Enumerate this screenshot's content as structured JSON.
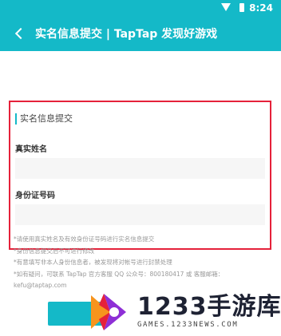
{
  "status_bar": {
    "time": "8:24"
  },
  "app_bar": {
    "title": "实名信息提交 | TapTap 发现好游戏"
  },
  "form": {
    "section_title": "实名信息提交",
    "name_label": "真实姓名",
    "id_label": "身份证号码"
  },
  "notes": [
    "*请使用真实姓名及有效身份证号码进行实名信息提交",
    "*身份信息提交后不可进行修改",
    "*有意填写非本人身份信息者，被发现将对帐号进行封禁处理",
    "*如有疑问，可联系 TapTap 官方客服 QQ 公众号：800180417 或 客服邮箱：",
    "kefu@taptap.com"
  ],
  "watermark": {
    "brand": "1233手游库",
    "domain": "GAMES.1233NEWS.COM",
    "colors": [
      "#f7941d",
      "#e5213a",
      "#8e2fd6",
      "#1e2233"
    ]
  },
  "colors": {
    "accent": "#14b9c8",
    "highlight_border": "#e5213a"
  }
}
